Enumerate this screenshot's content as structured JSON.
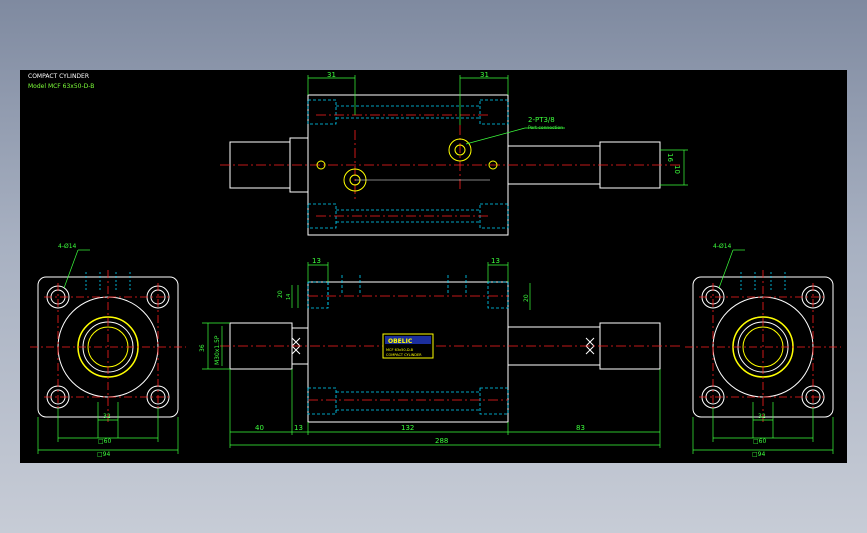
{
  "drawing": {
    "title": "COMPACT CYLINDER",
    "model_label": "Model",
    "model_value": "MCF 63x50-D-B"
  },
  "dimensions": {
    "top_left_31": "31",
    "top_right_31": "31",
    "port": "2-PT3/8",
    "port_sub": "Port connection",
    "right_10": "10",
    "right_16": "16",
    "front_13_left": "13",
    "front_13_right": "13",
    "front_20": "20",
    "front_14": "14",
    "front_20_right": "20",
    "front_36": "36",
    "thread": "M30x1.5P",
    "bottom_40": "40",
    "bottom_13": "13",
    "bottom_132": "132",
    "bottom_83": "83",
    "overall_288": "288",
    "left_hole": "4-Ø14",
    "left_32": "32",
    "left_60": "□60",
    "left_94": "□94",
    "right_hole": "4-Ø14",
    "right_32": "32",
    "right_60": "□60",
    "right_94": "□94"
  },
  "nameplate": {
    "brand": "OBELIC",
    "line1": "MCF 63x50-D-B",
    "line2": "COMPACT CYLINDER"
  },
  "colors": {
    "background": "#000000",
    "outline": "#ffffff",
    "hidden": "#00d8ff",
    "center": "#ff2020",
    "dimension": "#3cff3c",
    "port": "#ffff00"
  }
}
